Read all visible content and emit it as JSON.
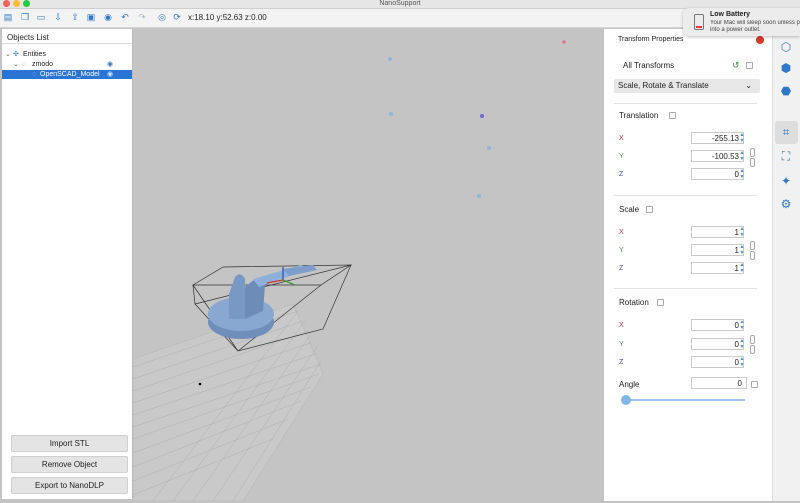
{
  "window": {
    "title": "NanoSupport"
  },
  "toolbar": {
    "icons": [
      "add-file-icon",
      "copy-icon",
      "folder-icon",
      "import-icon",
      "export-icon",
      "save-icon",
      "settings-icon",
      "undo-icon",
      "redo-icon",
      "view-icon",
      "rotate-view-icon"
    ],
    "coords": "x:18.10 y:52.63 z:0.00"
  },
  "notification": {
    "title": "Low Battery",
    "body_line1": "Your Mac will sleep soon unless p",
    "body_line2": "into a power outlet."
  },
  "objects_list": {
    "title": "Objects List",
    "tree": [
      {
        "label": "Entities",
        "level": 0
      },
      {
        "label": "zmodo",
        "level": 1
      },
      {
        "label": "OpenSCAD_Model",
        "level": 2,
        "selected": true
      }
    ],
    "buttons": {
      "import": "Import STL",
      "remove": "Remove Object",
      "export": "Export to NanoDLP"
    }
  },
  "transform": {
    "title": "Transform Properties",
    "all_transforms": "All Transforms",
    "mode": "Scale, Rotate & Translate",
    "translation": {
      "label": "Translation",
      "x": "-255.13",
      "y": "-100.53",
      "z": "0"
    },
    "scale": {
      "label": "Scale",
      "x": "1",
      "y": "1",
      "z": "1"
    },
    "rotation": {
      "label": "Rotation",
      "x": "0",
      "y": "0",
      "z": "0"
    },
    "angle": {
      "label": "Angle",
      "value": "0",
      "slider_fraction": 0
    },
    "axis_labels": {
      "x": "X",
      "y": "Y",
      "z": "Z"
    }
  },
  "colors": {
    "selection": "#2a74d4",
    "accent": "#2d78c8",
    "model": "#7f9fc8",
    "axis_x": "#d03030",
    "axis_y": "#3a9a3a",
    "axis_z": "#3050c0"
  }
}
